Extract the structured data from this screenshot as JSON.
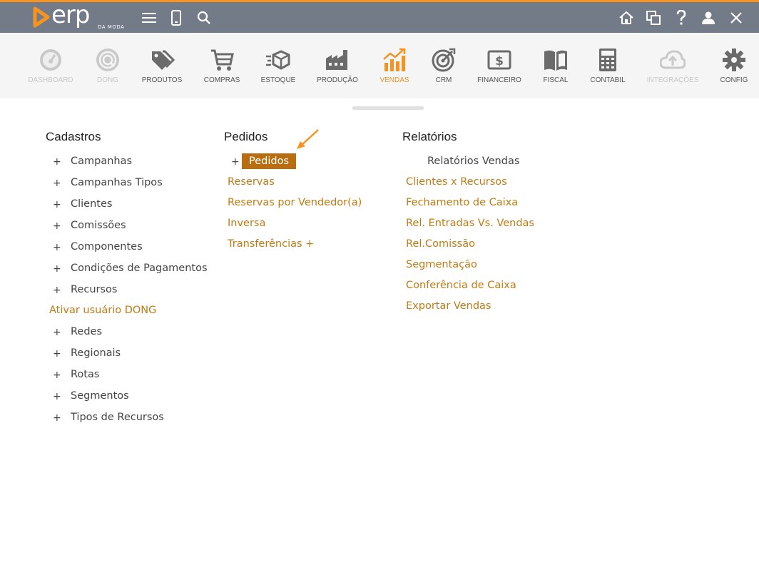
{
  "app": {
    "brand": "erp",
    "brand_sub": "DA MODA"
  },
  "colors": {
    "accent": "#f7931e",
    "topbar": "#737b89",
    "link": "#c07b12",
    "highlight": "#b86e10"
  },
  "topbar_icons": [
    "menu-icon",
    "mobile-icon",
    "search-icon",
    "home-icon",
    "windows-icon",
    "help-icon",
    "user-icon",
    "close-icon"
  ],
  "modules": [
    {
      "label": "DASHBOARD",
      "icon": "dashboard-icon",
      "state": "disabled"
    },
    {
      "label": "DONG",
      "icon": "dong-icon",
      "state": "disabled"
    },
    {
      "label": "PRODUTOS",
      "icon": "tags-icon",
      "state": "normal"
    },
    {
      "label": "COMPRAS",
      "icon": "cart-icon",
      "state": "normal"
    },
    {
      "label": "ESTOQUE",
      "icon": "box-icon",
      "state": "normal"
    },
    {
      "label": "PRODUÇÃO",
      "icon": "factory-icon",
      "state": "normal"
    },
    {
      "label": "VENDAS",
      "icon": "chart-up-icon",
      "state": "active"
    },
    {
      "label": "CRM",
      "icon": "target-icon",
      "state": "normal"
    },
    {
      "label": "FINANCEIRO",
      "icon": "money-icon",
      "state": "normal"
    },
    {
      "label": "FISCAL",
      "icon": "book-icon",
      "state": "normal"
    },
    {
      "label": "CONTABIL",
      "icon": "calculator-icon",
      "state": "normal"
    },
    {
      "label": "INTEGRAÇÕES",
      "icon": "cloud-upload-icon",
      "state": "disabled"
    },
    {
      "label": "CONFIG",
      "icon": "gear-icon",
      "state": "normal"
    }
  ],
  "cadastros": {
    "title": "Cadastros",
    "items": [
      {
        "plus": "+",
        "label": "Campanhas"
      },
      {
        "plus": "+",
        "label": "Campanhas Tipos"
      },
      {
        "plus": "+",
        "label": "Clientes"
      },
      {
        "plus": "+",
        "label": "Comissões"
      },
      {
        "plus": "+",
        "label": "Componentes"
      },
      {
        "plus": "+",
        "label": "Condições de Pagamentos"
      },
      {
        "plus": "+",
        "label": "Recursos"
      },
      {
        "plus": "",
        "label": "Ativar usuário DONG"
      },
      {
        "plus": "+",
        "label": "Redes"
      },
      {
        "plus": "+",
        "label": "Regionais"
      },
      {
        "plus": "+",
        "label": "Rotas"
      },
      {
        "plus": "+",
        "label": "Segmentos"
      },
      {
        "plus": "+",
        "label": "Tipos de Recursos"
      }
    ]
  },
  "pedidos": {
    "title": "Pedidos",
    "highlight_plus": "+",
    "highlight_label": "Pedidos",
    "links": [
      "Reservas",
      "Reservas por Vendedor(a)",
      "Inversa",
      "Transferências +"
    ]
  },
  "relatorios": {
    "title": "Relatórios",
    "subtitle": "Relatórios Vendas",
    "links": [
      "Clientes x Recursos",
      "Fechamento de Caixa",
      "Rel. Entradas Vs. Vendas",
      "Rel.Comissão",
      "Segmentação",
      "Conferência de Caixa",
      "Exportar Vendas"
    ]
  }
}
